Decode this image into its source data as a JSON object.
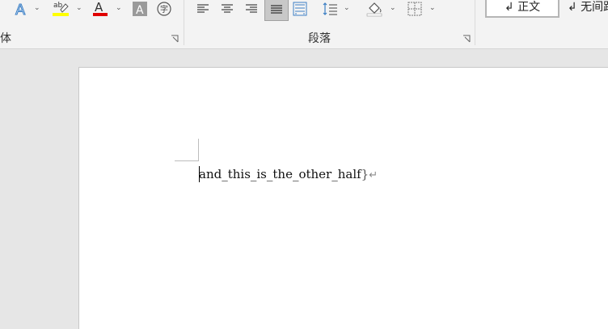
{
  "ribbon": {
    "font_group_label": "体",
    "paragraph_group_label": "段落",
    "styles": {
      "normal": "↲ 正文",
      "no_spacing": "↲ 无间距"
    }
  },
  "document": {
    "text": "and_this_is_the_other_half",
    "brace": "}",
    "paragraph_mark": "↵"
  }
}
